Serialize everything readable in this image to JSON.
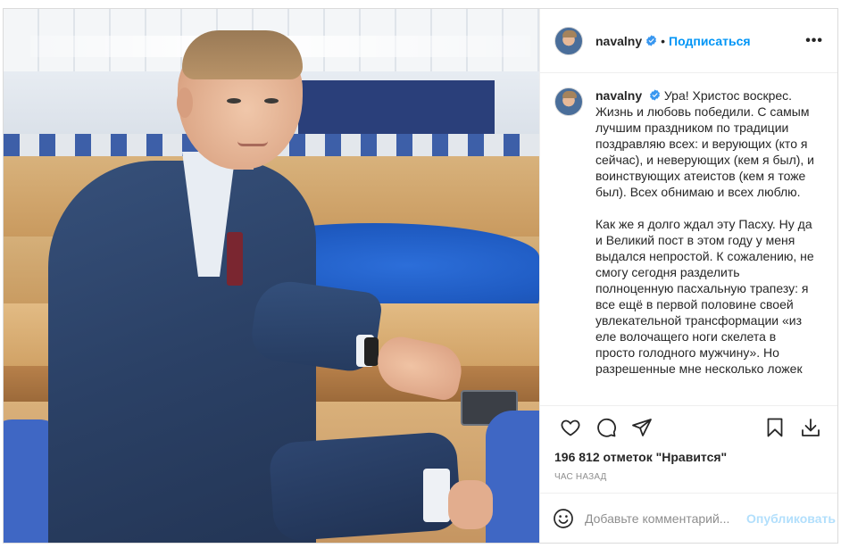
{
  "post": {
    "author": {
      "username": "navalny",
      "verified": true,
      "follow_label": "Подписаться",
      "separator": "•",
      "more_label": "•••"
    },
    "image": {
      "icon": "photo-of-man-in-suit-at-desk"
    },
    "caption": {
      "username": "navalny",
      "paragraphs": [
        "Ура! Христос воскрес. Жизнь и любовь победили. С самым лучшим праздником по традиции поздравляю всех: и верующих (кто я сейчас), и неверующих (кем я был), и воинствующих атеистов (кем я тоже был). Всех обнимаю и всех люблю.",
        "Как же я долго ждал эту Пасху. Ну да и Великий пост в этом году у меня выдался непростой. К сожалению, не смогу сегодня разделить полноценную пасхальную трапезу: я все ещё в первой половине своей увлекательной трансформации «из еле волочащего ноги скелета в просто голодного мужчину». Но разрешенные мне несколько ложек"
      ]
    },
    "actions": {
      "like_icon": "heart-icon",
      "comment_icon": "comment-bubble-icon",
      "share_icon": "paper-plane-icon",
      "save_icon": "bookmark-icon",
      "download_icon": "download-icon"
    },
    "likes_text": "196 812 отметок \"Нравится\"",
    "time_text": "час назад",
    "comment_box": {
      "placeholder": "Добавьте комментарий...",
      "publish_label": "Опубликовать",
      "emoji_icon": "smiley-icon"
    },
    "colors": {
      "accent": "#0095f6",
      "publish_disabled": "#b2dffc",
      "verified": "#3897f0",
      "border": "#dbdbdb"
    }
  }
}
